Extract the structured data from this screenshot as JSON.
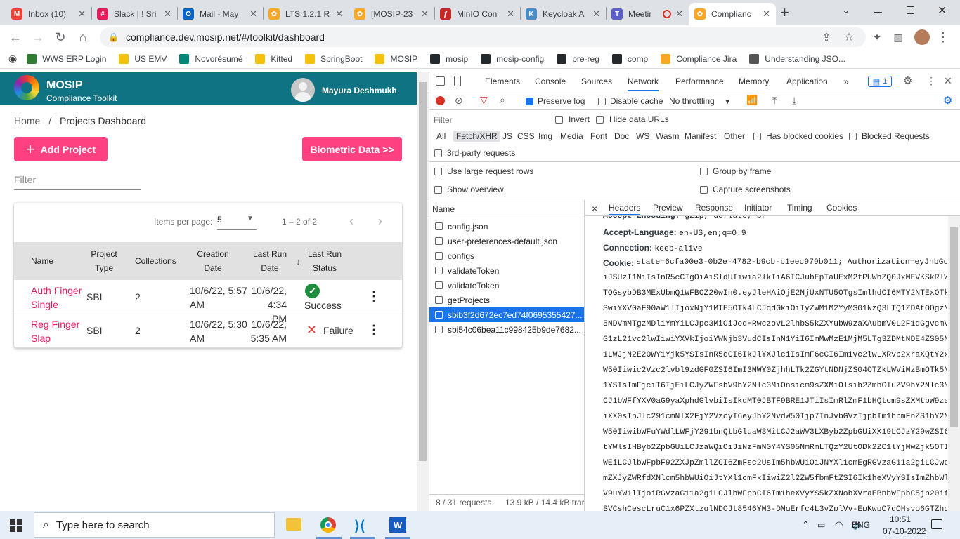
{
  "browser": {
    "tabs": [
      {
        "title": "Inbox (10)",
        "fav": "M",
        "color": "#ea4335"
      },
      {
        "title": "Slack | ! Sri",
        "fav": "#",
        "color": "#e01e5a"
      },
      {
        "title": "Mail - May",
        "fav": "O",
        "color": "#0a64c8"
      },
      {
        "title": "LTS 1.2.1 R",
        "fav": "✿",
        "color": "#f9a825"
      },
      {
        "title": "[MOSIP-23",
        "fav": "✿",
        "color": "#f9a825"
      },
      {
        "title": "MinIO Con",
        "fav": "ƒ",
        "color": "#c62828"
      },
      {
        "title": "Keycloak A",
        "fav": "K",
        "color": "#4a8cc7"
      },
      {
        "title": "Meetir",
        "fav": "T",
        "color": "#5b5fc7"
      },
      {
        "title": "Complianc",
        "fav": "✿",
        "color": "#f9a825"
      }
    ],
    "new_tab": "+",
    "url": "compliance.dev.mosip.net/#/toolkit/dashboard",
    "bookmarks": [
      {
        "label": "WWS ERP Login",
        "color": "#2e7d32"
      },
      {
        "label": "US EMV",
        "color": "#f4c20d"
      },
      {
        "label": "Novorésumé",
        "color": "#00897b"
      },
      {
        "label": "Kitted",
        "color": "#f4c20d"
      },
      {
        "label": "SpringBoot",
        "color": "#f4c20d"
      },
      {
        "label": "MOSIP",
        "color": "#f4c20d"
      },
      {
        "label": "mosip",
        "color": "#24292e"
      },
      {
        "label": "mosip-config",
        "color": "#24292e"
      },
      {
        "label": "pre-reg",
        "color": "#24292e"
      },
      {
        "label": "comp",
        "color": "#24292e"
      },
      {
        "label": "Compliance Jira",
        "color": "#f9a825"
      },
      {
        "label": "Understanding JSO...",
        "color": "#555555"
      }
    ]
  },
  "app": {
    "brand": "MOSIP",
    "subtitle": "Compliance Toolkit",
    "user": "Mayura Deshmukh",
    "breadcrumb_home": "Home",
    "breadcrumb_sep": "/",
    "breadcrumb_current": "Projects Dashboard",
    "add_project": "Add Project",
    "biometric": "Biometric Data >>",
    "filter_placeholder": "Filter",
    "items_per_page_label": "Items per page:",
    "items_per_page_value": "5",
    "range": "1 – 2 of 2",
    "columns": {
      "name": "Name",
      "project_type_1": "Project",
      "project_type_2": "Type",
      "collections": "Collections",
      "creation_1": "Creation",
      "creation_2": "Date",
      "lastrun_1": "Last Run",
      "lastrun_2": "Date",
      "status_1": "Last Run",
      "status_2": "Status"
    },
    "rows": [
      {
        "name1": "Auth Finger",
        "name2": "Single",
        "type": "SBI",
        "collections": "2",
        "created1": "10/6/22, 5:57",
        "created2": "AM",
        "lastrun1": "10/6/22,",
        "lastrun2": "4:34 PM",
        "status": "Success",
        "icon": "✔",
        "icon_color": "#1e8e3e"
      },
      {
        "name1": "Reg Finger",
        "name2": "Slap",
        "type": "SBI",
        "collections": "2",
        "created1": "10/6/22, 5:30",
        "created2": "AM",
        "lastrun1": "10/6/22,",
        "lastrun2": "5:35 AM",
        "status": "Failure",
        "icon": "✕",
        "icon_color": "#e53935"
      }
    ]
  },
  "devtools": {
    "tabs": [
      "Elements",
      "Console",
      "Sources",
      "Network",
      "Performance",
      "Memory",
      "Application"
    ],
    "active_tab": "Network",
    "issues_count": "1",
    "preserve_log": "Preserve log",
    "disable_cache": "Disable cache",
    "throttling": "No throttling",
    "filter": "Filter",
    "invert": "Invert",
    "hide_data_urls": "Hide data URLs",
    "types": [
      "All",
      "Fetch/XHR",
      "JS",
      "CSS",
      "Img",
      "Media",
      "Font",
      "Doc",
      "WS",
      "Wasm",
      "Manifest",
      "Other"
    ],
    "has_blocked_cookies": "Has blocked cookies",
    "blocked_requests": "Blocked Requests",
    "third_party": "3rd-party requests",
    "large_rows": "Use large request rows",
    "group_by_frame": "Group by frame",
    "show_overview": "Show overview",
    "capture_screenshots": "Capture screenshots",
    "name_header": "Name",
    "requests": [
      "config.json",
      "user-preferences-default.json",
      "configs",
      "validateToken",
      "validateToken",
      "getProjects",
      "sbib3f2d672ec7ed74f0695355427...",
      "sbi54c06bea11c998425b9de7682..."
    ],
    "selected_index": 6,
    "summary_count": "8 / 31 requests",
    "summary_size": "13.9 kB / 14.4 kB trar",
    "detail_close": "×",
    "detail_tabs": [
      "Headers",
      "Preview",
      "Response",
      "Initiator",
      "Timing",
      "Cookies"
    ],
    "header_partial": "Accept-Encoding: gzip, deflate, br",
    "accept_language_key": "Accept-Language:",
    "accept_language_val": "en-US,en;q=0.9",
    "connection_key": "Connection:",
    "connection_val": "keep-alive",
    "cookie_key": "Cookie:",
    "cookie_lines": [
      "state=6cfa00e3-0b2e-4782-b9cb-b1eec979b011; Authorization=eyJhbGciO",
      "iJSUzI1NiIsInR5cCIgOiAiSldUIiwia2lkIiA6ICJubEpTaUExM2tPUWhZQ0JxMEVKSkRlWnF",
      "TOGsybDB3MExUbmQ1WFBCZ20wIn0.eyJleHAiOjE2NjUxNTU5OTgsImlhdCI6MTY2NTExOTk5O",
      "SwiYXV0aF90aW1lIjoxNjY1MTE5OTk4LCJqdGkiOiIyZWM1M2YyMS01NzQ3LTQ1ZDAtODgzMi0",
      "5NDVmMTgzMDliYmYiLCJpc3MiOiJodHRwczovL2lhbS5kZXYubW9zaXAubmV0L2F1dGgvcmVhb",
      "G1zL21vc2lwIiwiYXVkIjoiYWNjb3VudCIsInN1YiI6ImMwMzE1MjM5LTg3ZDMtNDE4ZS05N2Q",
      "1LWJjN2E2OWY1Yjk5YSIsInR5cCI6IkJlYXJlciIsImF6cCI6Im1vc2lwLXRvb2xraXQtY2xpZ",
      "W50Iiwic2Vzc2lvbl9zdGF0ZSI6ImI3MWY0ZjhhLTk2ZGYtNDNjZS04OTZkLWViMzBmOTk5MjI",
      "1YSIsImFjciI6IjEiLCJyZWFsbV9hY2Nlc3MiOnsicm9sZXMiOlsib2ZmbGluZV9hY2Nlc3MiL",
      "CJ1bWFfYXV0aG9yaXphdGlvbiIsIkdMT0JBTF9BRE1JTiIsImRlZmF1bHQtcm9sZXMtbW9zaXA",
      "iXX0sInJlc291cmNlX2FjY2VzcyI6eyJhY2NvdW50Ijp7InJvbGVzIjpbIm1hbmFnZS1hY2Nvd",
      "W50IiwibWFuYWdlLWFjY291bnQtbGluaW3MiLCJ2aWV3LXByb2ZpbGUiXX19LCJzY29wZSI6ImV",
      "tYWlsIHByb2ZpbGUiLCJzaWQiOiJiNzFmNGY4YS05NmRmLTQzY2UtODk2ZC1lYjMwZjk5OTI2N",
      "WEiLCJlbWFpbF92ZXJpZmllZCI6ZmFsc2UsIm5hbWUiOiJNYXl1cmEgRGVzaG11a2giLCJwcmV",
      "mZXJyZWRfdXNlcm5hbWUiOiJtYXl1cmFkIiwiZ2l2ZW5fbmFtZSI6Ik1heXVyYSIsImZhbWlse",
      "V9uYW1lIjoiRGVzaG11a2giLCJlbWFpbCI6Im1heXVyYS5kZXNobXVraEBnbWFpbC5jb20ifQ.",
      "SVCshCescLruC1x6PZXtzglNDOJt8546YM3-DMgErfc4L3yZplVv-EpKwpC7dOHsyo6GTZhgdk"
    ]
  },
  "taskbar": {
    "search_placeholder": "Type here to search",
    "lang": "ENG",
    "time": "10:51",
    "date": "07-10-2022"
  }
}
